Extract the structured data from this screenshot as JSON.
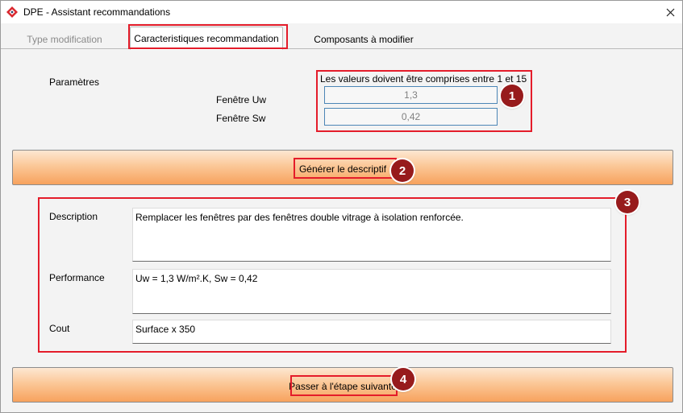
{
  "window": {
    "title": "DPE - Assistant recommandations",
    "close_label": "✕"
  },
  "tabs": [
    {
      "label": "Type modification",
      "state": "disabled"
    },
    {
      "label": "Caracteristiques recommandation",
      "state": "active"
    },
    {
      "label": "Composants à modifier",
      "state": "normal"
    }
  ],
  "parametres": {
    "section_label": "Paramètres",
    "hint": "Les valeurs doivent être comprises entre 1 et 15",
    "fields": [
      {
        "label": "Fenêtre Uw",
        "value": "1,3"
      },
      {
        "label": "Fenêtre Sw",
        "value": "0,42"
      }
    ]
  },
  "generate_button": {
    "label": "Générer le descriptif"
  },
  "descriptif": {
    "description": {
      "label": "Description",
      "value": "Remplacer les fenêtres par des fenêtres double vitrage à isolation renforcée."
    },
    "performance": {
      "label": "Performance",
      "value": "Uw = 1,3 W/m².K, Sw = 0,42"
    },
    "cout": {
      "label": "Cout",
      "value": "Surface x 350"
    }
  },
  "next_button": {
    "label": "Passer à l'étape suivante"
  },
  "badges": [
    "1",
    "2",
    "3",
    "4"
  ],
  "colors": {
    "highlight": "#e41c2a",
    "badge": "#971b1c",
    "button_gradient_top": "#fde7d2",
    "button_gradient_bottom": "#f7a25d",
    "field_border": "#4c86b6"
  }
}
